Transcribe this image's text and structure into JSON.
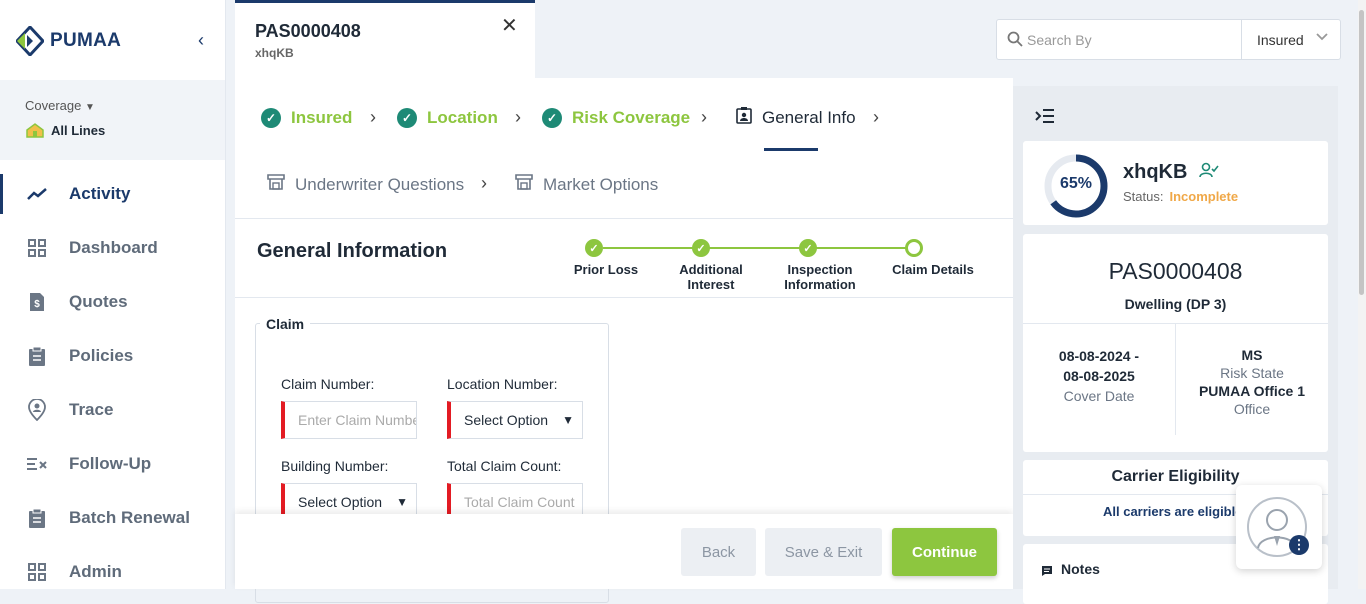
{
  "brand": {
    "name": "PUMAA"
  },
  "coverage": {
    "label": "Coverage",
    "value": "All Lines"
  },
  "nav": [
    {
      "label": "Activity",
      "icon": "trending-up-icon"
    },
    {
      "label": "Dashboard",
      "icon": "grid-icon"
    },
    {
      "label": "Quotes",
      "icon": "dollar-doc-icon"
    },
    {
      "label": "Policies",
      "icon": "clipboard-icon"
    },
    {
      "label": "Trace",
      "icon": "location-person-icon"
    },
    {
      "label": "Follow-Up",
      "icon": "list-check-icon"
    },
    {
      "label": "Batch Renewal",
      "icon": "clipboard-icon"
    },
    {
      "label": "Admin",
      "icon": "grid-icon"
    }
  ],
  "tab": {
    "title": "PAS0000408",
    "subtitle": "xhqKB"
  },
  "search": {
    "placeholder": "Search By",
    "filter": "Insured"
  },
  "steps": {
    "insured": "Insured",
    "location": "Location",
    "risk": "Risk Coverage",
    "general": "General Info",
    "underwriter": "Underwriter Questions",
    "market": "Market Options"
  },
  "section": {
    "title": "General Information"
  },
  "progress": {
    "prior_loss": "Prior Loss",
    "additional_interest_1": "Additional",
    "additional_interest_2": "Interest",
    "inspection_1": "Inspection",
    "inspection_2": "Information",
    "claim_details": "Claim Details"
  },
  "claim": {
    "legend": "Claim",
    "claim_number_label": "Claim Number:",
    "claim_number_placeholder": "Enter Claim Number",
    "location_number_label": "Location Number:",
    "location_number_value": "Select Option",
    "building_number_label": "Building Number:",
    "building_number_value": "Select Option",
    "total_claim_label": "Total Claim Count:",
    "total_claim_placeholder": "Total Claim Count"
  },
  "footer": {
    "back": "Back",
    "save_exit": "Save & Exit",
    "continue": "Continue"
  },
  "summary": {
    "percent": "65%",
    "percent_value": 0.65,
    "name": "xhqKB",
    "status_label": "Status:",
    "status_value": "Incomplete",
    "policy": "PAS0000408",
    "form": "Dwelling (DP 3)",
    "date_line1": "08-08-2024 -",
    "date_line2": "08-08-2025",
    "date_caption": "Cover Date",
    "state": "MS",
    "state_caption": "Risk State",
    "office": "PUMAA Office 1",
    "office_caption": "Office",
    "carrier_title": "Carrier Eligibility",
    "carrier_text": "All carriers are eligible",
    "notes": "Notes"
  },
  "colors": {
    "brand": "#1b3a6b",
    "accent": "#8dc63f",
    "check": "#1e8a76",
    "warning": "#f0a848",
    "required": "#e31b23"
  }
}
